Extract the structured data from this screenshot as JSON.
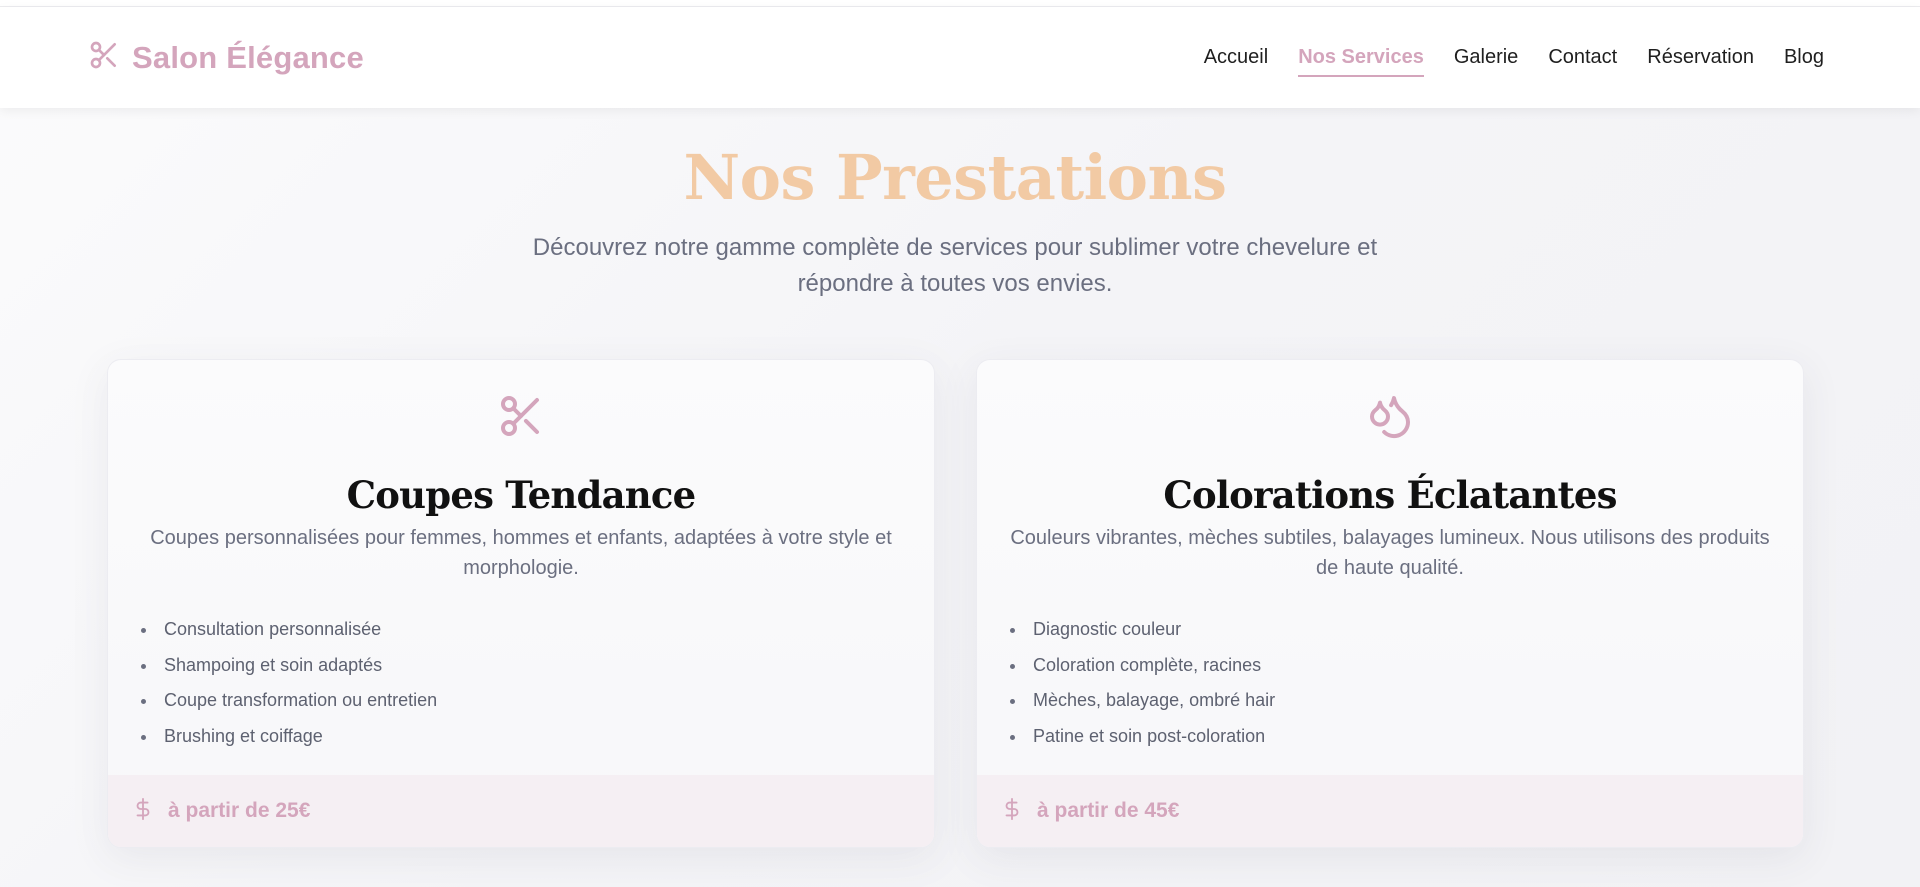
{
  "brand": {
    "name": "Salon Élégance",
    "icon": "scissors-icon"
  },
  "nav": {
    "items": [
      {
        "label": "Accueil",
        "active": false
      },
      {
        "label": "Nos Services",
        "active": true
      },
      {
        "label": "Galerie",
        "active": false
      },
      {
        "label": "Contact",
        "active": false
      },
      {
        "label": "Réservation",
        "active": false
      },
      {
        "label": "Blog",
        "active": false
      }
    ]
  },
  "hero": {
    "title": "Nos Prestations",
    "subtitle": "Découvrez notre gamme complète de services pour sublimer votre chevelure et répondre à toutes vos envies."
  },
  "cards": [
    {
      "icon": "scissors-icon",
      "title": "Coupes Tendance",
      "description": "Coupes personnalisées pour femmes, hommes et enfants, adaptées à votre style et morphologie.",
      "features": [
        "Consultation personnalisée",
        "Shampoing et soin adaptés",
        "Coupe transformation ou entretien",
        "Brushing et coiffage"
      ],
      "price_icon": "dollar-icon",
      "price": "à partir de 25€"
    },
    {
      "icon": "droplets-icon",
      "title": "Colorations Éclatantes",
      "description": "Couleurs vibrantes, mèches subtiles, balayages lumineux. Nous utilisons des produits de haute qualité.",
      "features": [
        "Diagnostic couleur",
        "Coloration complète, racines",
        "Mèches, balayage, ombré hair",
        "Patine et soin post-coloration"
      ],
      "price_icon": "dollar-icon",
      "price": "à partir de 45€"
    }
  ],
  "colors": {
    "accent": "#d4a5bc",
    "hero_title": "#f2caa4",
    "text_muted": "#6b6f80",
    "heading": "#111111"
  }
}
